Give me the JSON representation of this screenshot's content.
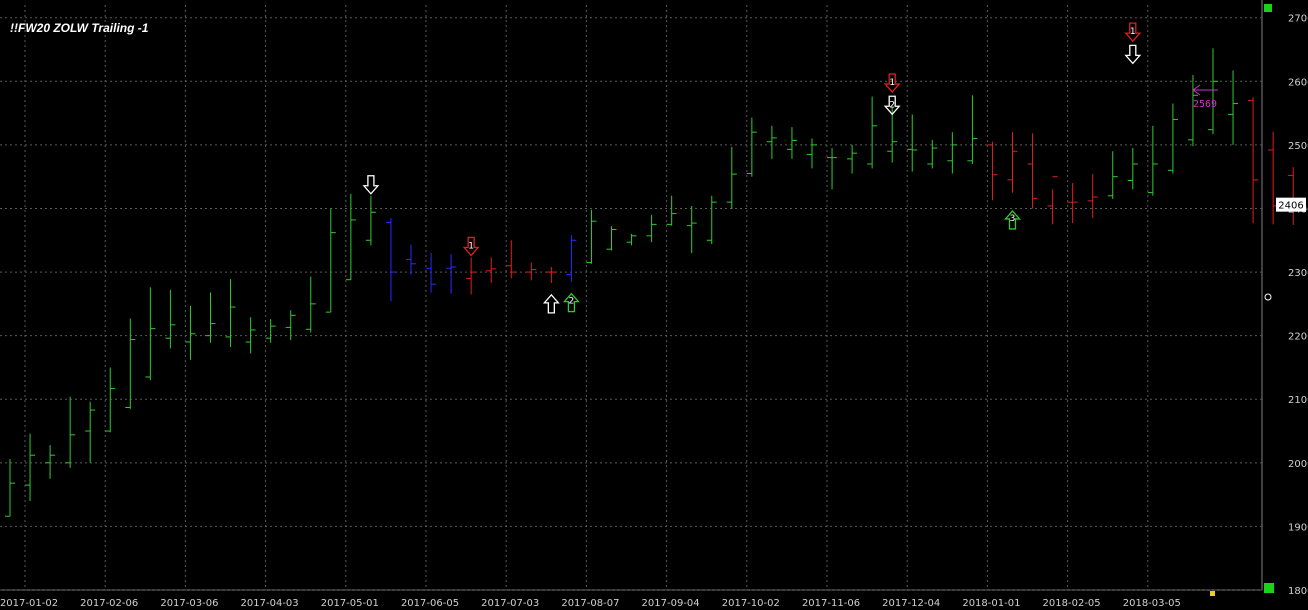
{
  "title": "!!FW20 ZOLW Trailing -1",
  "colors": {
    "background": "#000000",
    "grid": "#5a5a5a",
    "up": "#2ecc2e",
    "down_blue": "#2a2aff",
    "down_red": "#e02020",
    "marker_white": "#ffffff",
    "last_price_arrow": "#d030d0",
    "axis_text": "#d0d0d0"
  },
  "chart_data": {
    "type": "bar",
    "subtype": "ohlc-weekly",
    "x_ticks": [
      "2017-01-02",
      "2017-02-06",
      "2017-03-06",
      "2017-04-03",
      "2017-05-01",
      "2017-06-05",
      "2017-07-03",
      "2017-08-07",
      "2017-09-04",
      "2017-10-02",
      "2017-11-06",
      "2017-12-04",
      "2018-01-01",
      "2018-02-05",
      "2018-03-05"
    ],
    "y_ticks": [
      1800,
      1900,
      2000,
      2100,
      2200,
      2300,
      2400,
      2500,
      2600,
      2700
    ],
    "ylim": [
      1800,
      2720
    ],
    "grid": true,
    "last_price": 2406,
    "last_price_marker": 2569,
    "bars": [
      {
        "h": 2006,
        "l": 1916,
        "o": 1916,
        "c": 1968,
        "color": "green"
      },
      {
        "h": 2046,
        "l": 1940,
        "o": 1965,
        "c": 2012,
        "color": "green"
      },
      {
        "h": 2028,
        "l": 1975,
        "o": 2000,
        "c": 2012,
        "color": "green"
      },
      {
        "h": 2104,
        "l": 1992,
        "o": 2000,
        "c": 2044,
        "color": "green"
      },
      {
        "h": 2096,
        "l": 2000,
        "o": 2050,
        "c": 2083,
        "color": "green"
      },
      {
        "h": 2150,
        "l": 2048,
        "o": 2050,
        "c": 2117,
        "color": "green"
      },
      {
        "h": 2227,
        "l": 2085,
        "o": 2087,
        "c": 2194,
        "color": "green"
      },
      {
        "h": 2276,
        "l": 2130,
        "o": 2135,
        "c": 2211,
        "color": "green"
      },
      {
        "h": 2272,
        "l": 2180,
        "o": 2196,
        "c": 2217,
        "color": "green"
      },
      {
        "h": 2247,
        "l": 2162,
        "o": 2190,
        "c": 2203,
        "color": "green"
      },
      {
        "h": 2268,
        "l": 2189,
        "o": 2200,
        "c": 2219,
        "color": "green"
      },
      {
        "h": 2289,
        "l": 2182,
        "o": 2198,
        "c": 2245,
        "color": "green"
      },
      {
        "h": 2229,
        "l": 2172,
        "o": 2190,
        "c": 2209,
        "color": "green"
      },
      {
        "h": 2226,
        "l": 2189,
        "o": 2196,
        "c": 2215,
        "color": "green"
      },
      {
        "h": 2240,
        "l": 2193,
        "o": 2213,
        "c": 2232,
        "color": "green"
      },
      {
        "h": 2293,
        "l": 2205,
        "o": 2210,
        "c": 2250,
        "color": "green"
      },
      {
        "h": 2400,
        "l": 2237,
        "o": 2237,
        "c": 2362,
        "color": "green"
      },
      {
        "h": 2423,
        "l": 2288,
        "o": 2288,
        "c": 2382,
        "color": "green"
      },
      {
        "h": 2420,
        "l": 2342,
        "o": 2350,
        "c": 2394,
        "color": "green"
      },
      {
        "h": 2385,
        "l": 2254,
        "o": 2378,
        "c": 2300,
        "color": "blue"
      },
      {
        "h": 2343,
        "l": 2296,
        "o": 2320,
        "c": 2313,
        "color": "blue"
      },
      {
        "h": 2330,
        "l": 2268,
        "o": 2306,
        "c": 2281,
        "color": "blue"
      },
      {
        "h": 2328,
        "l": 2266,
        "o": 2306,
        "c": 2308,
        "color": "blue"
      },
      {
        "h": 2323,
        "l": 2265,
        "o": 2290,
        "c": 2300,
        "color": "red"
      },
      {
        "h": 2323,
        "l": 2283,
        "o": 2302,
        "c": 2305,
        "color": "red"
      },
      {
        "h": 2350,
        "l": 2290,
        "o": 2310,
        "c": 2300,
        "color": "red"
      },
      {
        "h": 2315,
        "l": 2287,
        "o": 2300,
        "c": 2304,
        "color": "red"
      },
      {
        "h": 2308,
        "l": 2283,
        "o": 2300,
        "c": 2300,
        "color": "red"
      },
      {
        "h": 2358,
        "l": 2285,
        "o": 2296,
        "c": 2350,
        "color": "blue"
      },
      {
        "h": 2398,
        "l": 2313,
        "o": 2315,
        "c": 2380,
        "color": "green"
      },
      {
        "h": 2372,
        "l": 2334,
        "o": 2336,
        "c": 2367,
        "color": "green"
      },
      {
        "h": 2360,
        "l": 2342,
        "o": 2347,
        "c": 2357,
        "color": "green"
      },
      {
        "h": 2390,
        "l": 2347,
        "o": 2357,
        "c": 2375,
        "color": "green"
      },
      {
        "h": 2420,
        "l": 2373,
        "o": 2375,
        "c": 2392,
        "color": "green"
      },
      {
        "h": 2404,
        "l": 2330,
        "o": 2373,
        "c": 2377,
        "color": "green"
      },
      {
        "h": 2420,
        "l": 2344,
        "o": 2350,
        "c": 2410,
        "color": "green"
      },
      {
        "h": 2497,
        "l": 2399,
        "o": 2410,
        "c": 2454,
        "color": "green"
      },
      {
        "h": 2543,
        "l": 2450,
        "o": 2455,
        "c": 2520,
        "color": "green"
      },
      {
        "h": 2530,
        "l": 2478,
        "o": 2505,
        "c": 2511,
        "color": "green"
      },
      {
        "h": 2528,
        "l": 2478,
        "o": 2493,
        "c": 2507,
        "color": "green"
      },
      {
        "h": 2510,
        "l": 2463,
        "o": 2485,
        "c": 2500,
        "color": "green"
      },
      {
        "h": 2495,
        "l": 2430,
        "o": 2480,
        "c": 2480,
        "color": "green"
      },
      {
        "h": 2500,
        "l": 2455,
        "o": 2478,
        "c": 2487,
        "color": "green"
      },
      {
        "h": 2576,
        "l": 2463,
        "o": 2470,
        "c": 2530,
        "color": "green"
      },
      {
        "h": 2560,
        "l": 2472,
        "o": 2490,
        "c": 2505,
        "color": "green"
      },
      {
        "h": 2548,
        "l": 2458,
        "o": 2493,
        "c": 2492,
        "color": "green"
      },
      {
        "h": 2508,
        "l": 2463,
        "o": 2470,
        "c": 2495,
        "color": "green"
      },
      {
        "h": 2520,
        "l": 2455,
        "o": 2475,
        "c": 2500,
        "color": "green"
      },
      {
        "h": 2578,
        "l": 2470,
        "o": 2475,
        "c": 2510,
        "color": "green"
      },
      {
        "h": 2505,
        "l": 2413,
        "o": 2500,
        "c": 2453,
        "color": "red"
      },
      {
        "h": 2520,
        "l": 2425,
        "o": 2445,
        "c": 2490,
        "color": "red"
      },
      {
        "h": 2518,
        "l": 2400,
        "o": 2470,
        "c": 2416,
        "color": "red"
      },
      {
        "h": 2430,
        "l": 2375,
        "o": 2404,
        "c": 2450,
        "color": "red"
      },
      {
        "h": 2440,
        "l": 2377,
        "o": 2410,
        "c": 2410,
        "color": "red"
      },
      {
        "h": 2454,
        "l": 2385,
        "o": 2412,
        "c": 2418,
        "color": "red"
      },
      {
        "h": 2490,
        "l": 2415,
        "o": 2420,
        "c": 2450,
        "color": "green"
      },
      {
        "h": 2495,
        "l": 2430,
        "o": 2444,
        "c": 2470,
        "color": "green"
      },
      {
        "h": 2530,
        "l": 2420,
        "o": 2425,
        "c": 2470,
        "color": "green"
      },
      {
        "h": 2565,
        "l": 2455,
        "o": 2460,
        "c": 2540,
        "color": "green"
      },
      {
        "h": 2610,
        "l": 2498,
        "o": 2508,
        "c": 2578,
        "color": "green"
      },
      {
        "h": 2652,
        "l": 2517,
        "o": 2524,
        "c": 2600,
        "color": "green"
      },
      {
        "h": 2617,
        "l": 2500,
        "o": 2548,
        "c": 2565,
        "color": "green"
      },
      {
        "h": 2575,
        "l": 2377,
        "o": 2570,
        "c": 2445,
        "color": "red"
      },
      {
        "h": 2521,
        "l": 2375,
        "o": 2492,
        "c": 2404,
        "color": "red"
      },
      {
        "h": 2465,
        "l": 2374,
        "o": 2452,
        "c": 2406,
        "color": "red"
      }
    ],
    "markers": [
      {
        "bar": 18,
        "type": "arrow-down",
        "color": "white",
        "label": "",
        "price": 2420
      },
      {
        "bar": 23,
        "type": "arrow-down",
        "color": "red",
        "label": "1",
        "price": 2323
      },
      {
        "bar": 27,
        "type": "arrow-up",
        "color": "white",
        "label": "",
        "price": 2283
      },
      {
        "bar": 28,
        "type": "arrow-up",
        "color": "green",
        "label": "2",
        "price": 2285
      },
      {
        "bar": 44,
        "type": "arrow-down",
        "color": "red",
        "label": "1",
        "price": 2580
      },
      {
        "bar": 44,
        "type": "arrow-down",
        "color": "white",
        "label": "2",
        "price": 2545
      },
      {
        "bar": 50,
        "type": "arrow-up",
        "color": "green",
        "label": "3",
        "price": 2415
      },
      {
        "bar": 56,
        "type": "arrow-down",
        "color": "red",
        "label": "1",
        "price": 2660
      },
      {
        "bar": 56,
        "type": "arrow-down",
        "color": "white",
        "label": "",
        "price": 2625
      }
    ]
  }
}
